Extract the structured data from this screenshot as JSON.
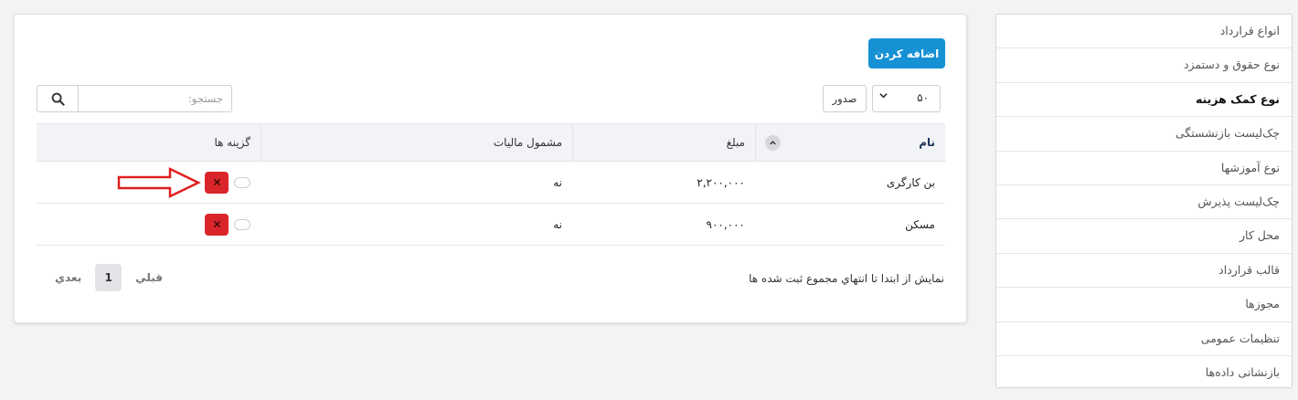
{
  "sidebar": {
    "items": [
      {
        "label": "انواع قرارداد"
      },
      {
        "label": "نوع حقوق و دستمزد"
      },
      {
        "label": "نوع کمک هزینه"
      },
      {
        "label": "چک‌لیست بازنشستگی"
      },
      {
        "label": "نوع آموزشها"
      },
      {
        "label": "چک‌لیست پذیرش"
      },
      {
        "label": "محل کار"
      },
      {
        "label": "قالب قرارداد"
      },
      {
        "label": "مجوزها"
      },
      {
        "label": "تنظیمات عمومی"
      },
      {
        "label": "بازنشانی داده‌ها"
      }
    ],
    "active_index": 2
  },
  "toolbar": {
    "add_label": "اضافه کردن",
    "page_size": "۵۰",
    "export_label": "صدور",
    "search_placeholder": "جستجو:"
  },
  "table": {
    "headers": {
      "name": "نام",
      "amount": "مبلغ",
      "tax": "مشمول مالیات",
      "options": "گزینه ها"
    },
    "rows": [
      {
        "name": "بن کارگری",
        "amount": "۲,۲۰۰,۰۰۰",
        "tax": "نه"
      },
      {
        "name": "مسکن",
        "amount": "۹۰۰,۰۰۰",
        "tax": "نه"
      }
    ]
  },
  "footer": {
    "info": "نمايش از ابتدا تا انتهاي مجموع ثبت شده ها",
    "prev_label": "قبلي",
    "current_page": "1",
    "next_label": "بعدي"
  },
  "colors": {
    "primary": "#1591d4",
    "danger": "#d9252a",
    "annotation": "#e02020"
  }
}
